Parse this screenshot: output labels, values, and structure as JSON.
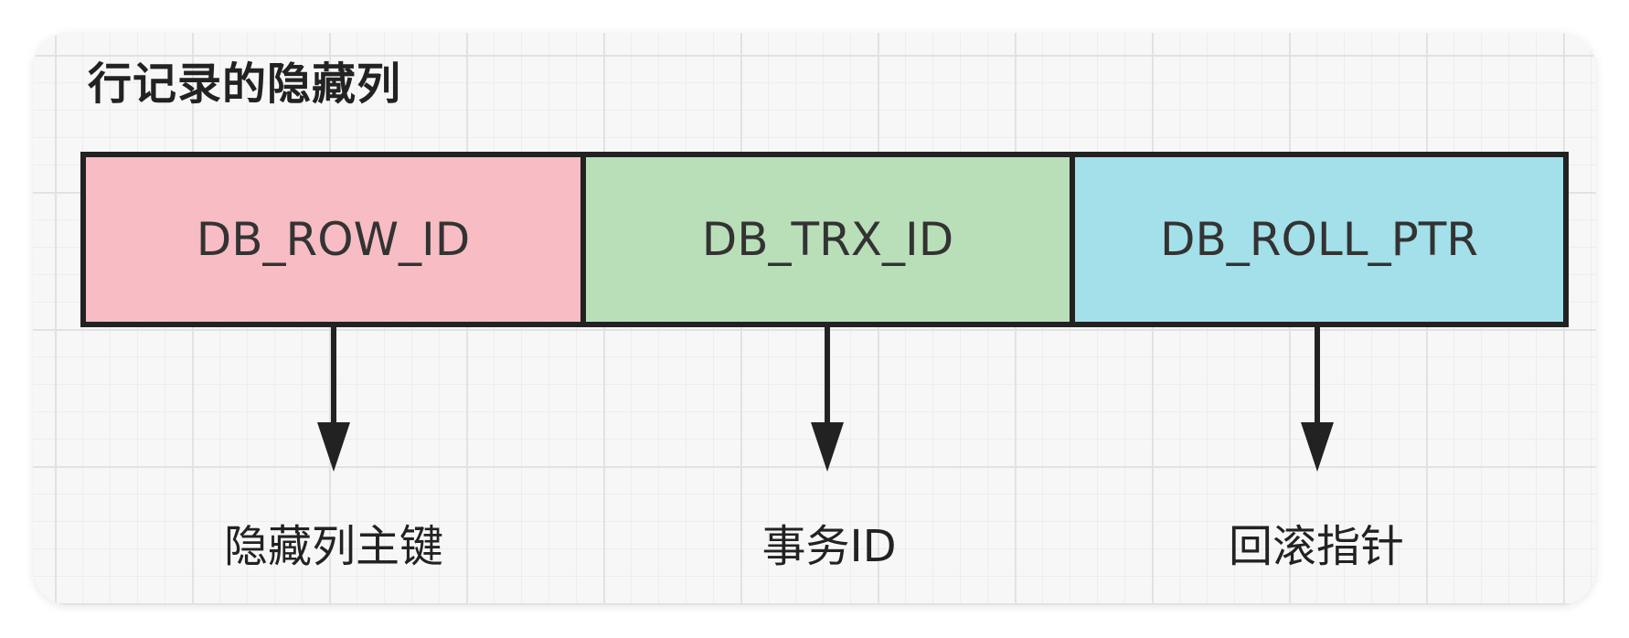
{
  "title": "行记录的隐藏列",
  "columns": [
    {
      "name": "DB_ROW_ID",
      "color": "#f7bcc4",
      "description": "隐藏列主键"
    },
    {
      "name": "DB_TRX_ID",
      "color": "#b9dfb9",
      "description": "事务ID"
    },
    {
      "name": "DB_ROLL_PTR",
      "color": "#a3e0ea",
      "description": "回滚指针"
    }
  ],
  "colors": {
    "border": "#222222",
    "card_background": "#f7f7f7",
    "grid": "#e2e2e2"
  }
}
